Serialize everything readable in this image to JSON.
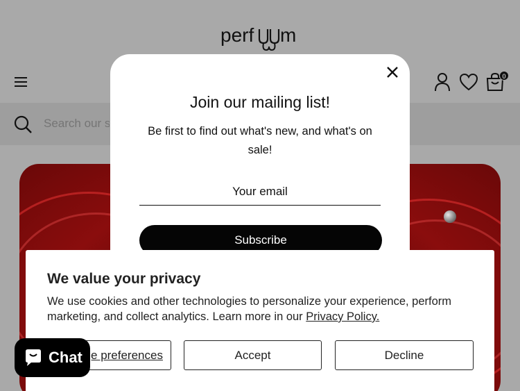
{
  "header": {
    "logo_text": "perfuum",
    "cart_count": "0",
    "icons": [
      "menu-icon",
      "account-icon",
      "wishlist-heart-icon",
      "cart-bag-icon"
    ]
  },
  "search": {
    "placeholder": "Search our store"
  },
  "popup": {
    "title": "Join our mailing list!",
    "description": "Be first to find out what's new, and what's on sale!",
    "email_placeholder": "Your email",
    "subscribe_label": "Subscribe"
  },
  "cookie_banner": {
    "title": "We value your privacy",
    "text": "We use cookies and other technologies to personalize your experience, perform marketing, and collect analytics. Learn more in our",
    "policy_link": "Privacy Policy.",
    "preferences_label": "Manage preferences",
    "accept_label": "Accept",
    "decline_label": "Decline"
  },
  "chat": {
    "label": "Chat"
  },
  "colors": {
    "overlay": "#a9a9a9",
    "hero_red": "#8a0d0d",
    "button_black": "#050505"
  }
}
